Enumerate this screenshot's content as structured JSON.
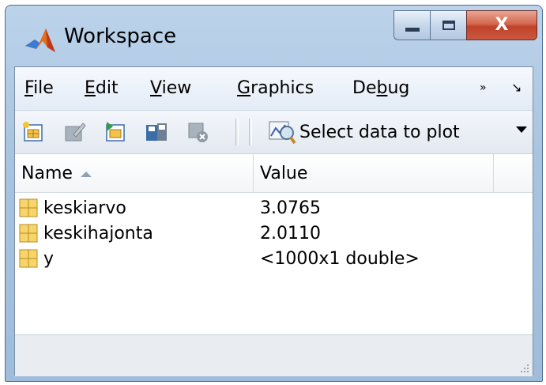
{
  "window": {
    "title": "Workspace",
    "close_glyph": "X"
  },
  "menu": {
    "items": [
      "File",
      "Edit",
      "View",
      "Graphics",
      "Debug"
    ],
    "underline": [
      "F",
      "E",
      "V",
      "G",
      "b"
    ],
    "overflow": "»",
    "corner": "↘"
  },
  "toolbar": {
    "icons": [
      "new-variable-icon",
      "edit-icon",
      "import-data-icon",
      "save-icon",
      "delete-icon"
    ],
    "plot_selector": {
      "label": "Select data to plot",
      "icon": "plot-magnifier-icon"
    }
  },
  "table": {
    "columns": [
      "Name",
      "Value"
    ],
    "sort": "ascending",
    "rows": [
      {
        "name": "keskiarvo",
        "value": "3.0765"
      },
      {
        "name": "keskihajonta",
        "value": "2.0110"
      },
      {
        "name": "y",
        "value": "<1000x1 double>"
      }
    ]
  },
  "colors": {
    "frame": "#a9c4e0",
    "close": "#c94a32",
    "variable_icon": "#f2c24a"
  }
}
